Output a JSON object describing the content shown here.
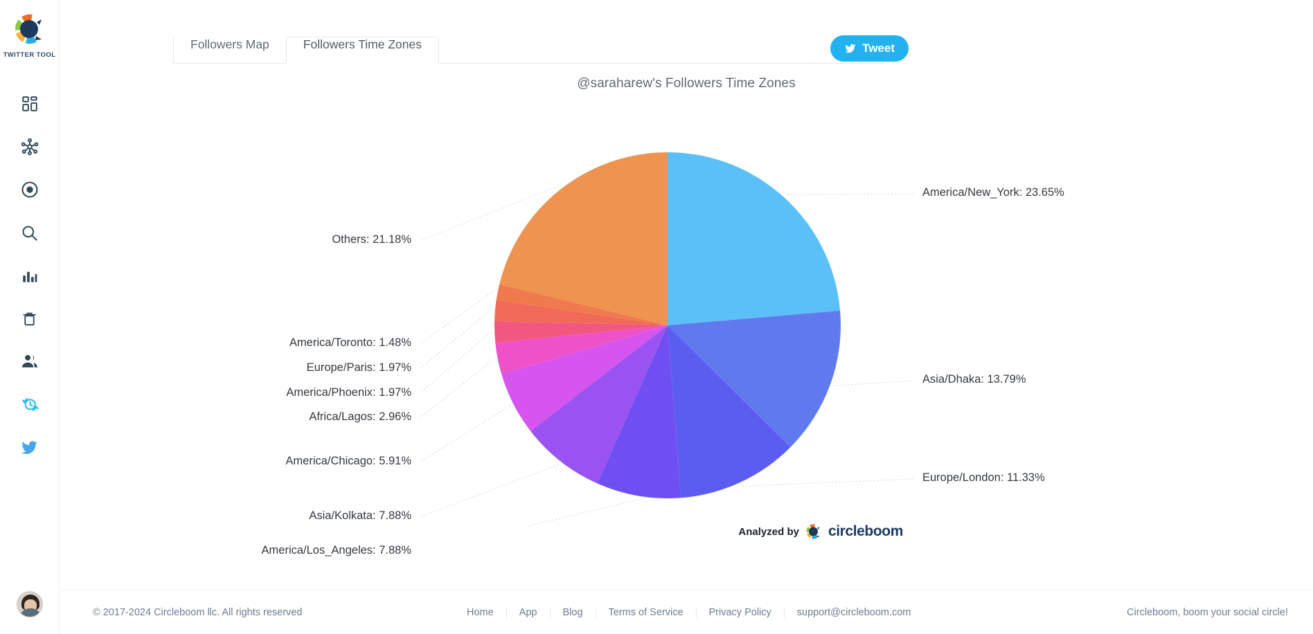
{
  "brand": {
    "name": "TWITTER TOOL",
    "logo_icon": "circleboom-logo-icon"
  },
  "sidebar": {
    "items": [
      {
        "id": "dashboard",
        "icon": "dashboard-grid-icon",
        "active": false
      },
      {
        "id": "network",
        "icon": "network-nodes-icon",
        "active": false
      },
      {
        "id": "target",
        "icon": "target-circle-icon",
        "active": false
      },
      {
        "id": "search",
        "icon": "search-icon",
        "active": false
      },
      {
        "id": "analytics",
        "icon": "bar-chart-icon",
        "active": false
      },
      {
        "id": "delete",
        "icon": "trash-icon",
        "active": false
      },
      {
        "id": "users",
        "icon": "users-icon",
        "active": false
      },
      {
        "id": "history",
        "icon": "clock-refresh-icon",
        "active": true
      },
      {
        "id": "twitter",
        "icon": "twitter-bird-icon",
        "active": false
      }
    ],
    "avatar_name": "user-avatar"
  },
  "tabs": [
    {
      "id": "followers-map",
      "label": "Followers Map",
      "active": false
    },
    {
      "id": "followers-time-zones",
      "label": "Followers Time Zones",
      "active": true
    }
  ],
  "tweet_button": {
    "label": "Tweet",
    "icon": "twitter-bird-icon",
    "color": "#23b2f0"
  },
  "analyzed_by": {
    "prefix": "Analyzed by",
    "brand": "circleboom"
  },
  "footer": {
    "copyright": "© 2017-2024 Circleboom llc. All rights reserved",
    "links": [
      {
        "id": "home",
        "label": "Home"
      },
      {
        "id": "app",
        "label": "App"
      },
      {
        "id": "blog",
        "label": "Blog"
      },
      {
        "id": "terms",
        "label": "Terms of Service"
      },
      {
        "id": "privacy",
        "label": "Privacy Policy"
      },
      {
        "id": "support",
        "label": "support@circleboom.com"
      }
    ],
    "tagline": "Circleboom, boom your social circle!"
  },
  "chart_data": {
    "type": "pie",
    "title": "@saraharew's Followers Time Zones",
    "xlabel": "",
    "ylabel": "",
    "label_format": "{name}: {value}%",
    "start_angle_deg": 0,
    "direction": "clockwise",
    "categories": [
      "America/New_York",
      "Asia/Dhaka",
      "Europe/London",
      "America/Los_Angeles",
      "Asia/Kolkata",
      "America/Chicago",
      "Africa/Lagos",
      "America/Phoenix",
      "Europe/Paris",
      "America/Toronto",
      "Others"
    ],
    "values": [
      23.65,
      13.79,
      11.33,
      7.88,
      7.88,
      5.91,
      2.96,
      1.97,
      1.97,
      1.48,
      21.18
    ],
    "colors": [
      "#5bc0f8",
      "#6179ef",
      "#5b5df0",
      "#6f4ff2",
      "#9a52f0",
      "#d655ee",
      "#ef52c8",
      "#f2577f",
      "#f06a57",
      "#f07a4e",
      "#ee9450"
    ],
    "labels": [
      "America/New_York: 23.65%",
      "Asia/Dhaka: 13.79%",
      "Europe/London: 11.33%",
      "America/Los_Angeles: 7.88%",
      "Asia/Kolkata: 7.88%",
      "America/Chicago: 5.91%",
      "Africa/Lagos: 2.96%",
      "America/Phoenix: 1.97%",
      "Europe/Paris: 1.97%",
      "America/Toronto: 1.48%",
      "Others: 21.18%"
    ],
    "label_sides": [
      "right",
      "right",
      "right",
      "left",
      "left",
      "left",
      "left",
      "left",
      "left",
      "left",
      "left"
    ],
    "legend_position": "callout-labels",
    "grid": false
  }
}
